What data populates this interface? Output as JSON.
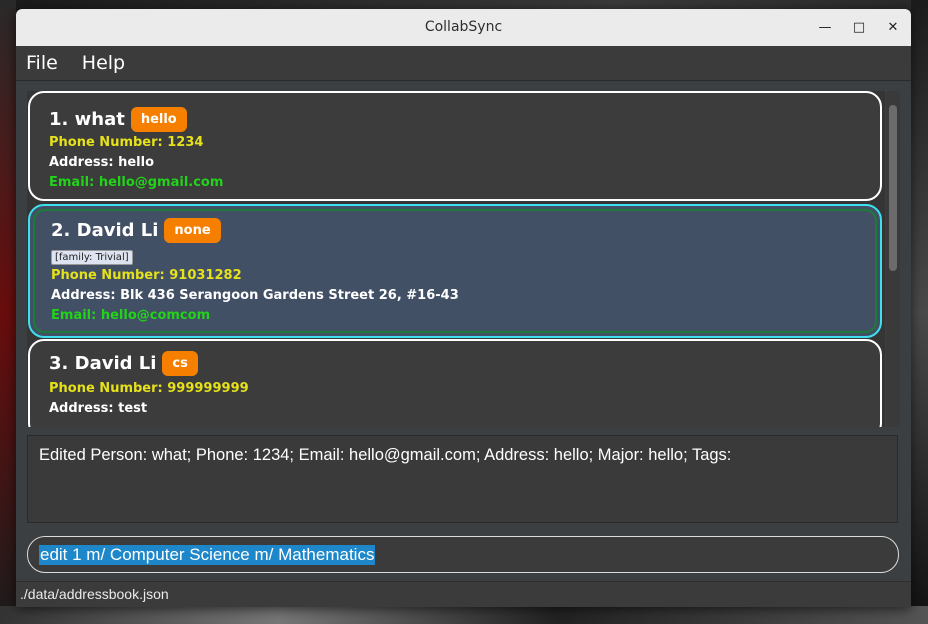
{
  "window": {
    "title": "CollabSync",
    "minimize": "—",
    "maximize": "□",
    "close": "✕"
  },
  "menu": {
    "file": "File",
    "help": "Help"
  },
  "persons": [
    {
      "name": "1.  what",
      "badge": "hello",
      "phone": "Phone Number: 1234",
      "address": "Address: hello",
      "email": "Email: hello@gmail.com"
    },
    {
      "name": "2.  David Li",
      "badge": "none",
      "tag": "[family: Trivial]",
      "phone": "Phone Number: 91031282",
      "address": "Address: Blk 436 Serangoon Gardens Street 26, #16-43",
      "email": "Email: hello@comcom"
    },
    {
      "name": "3.  David Li",
      "badge": "cs",
      "phone": "Phone Number: 999999999",
      "address": "Address: test"
    }
  ],
  "result": "Edited Person: what; Phone: 1234; Email: hello@gmail.com; Address: hello; Major: hello; Tags:",
  "command": "edit 1 m/ Computer Science m/ Mathematics",
  "status": "./data/addressbook.json",
  "colors": {
    "badge": "#f77f00",
    "phone": "#e5e11a",
    "email": "#22d31a",
    "selected_border": "#3de0ee",
    "selection_highlight": "#1d87c9"
  }
}
